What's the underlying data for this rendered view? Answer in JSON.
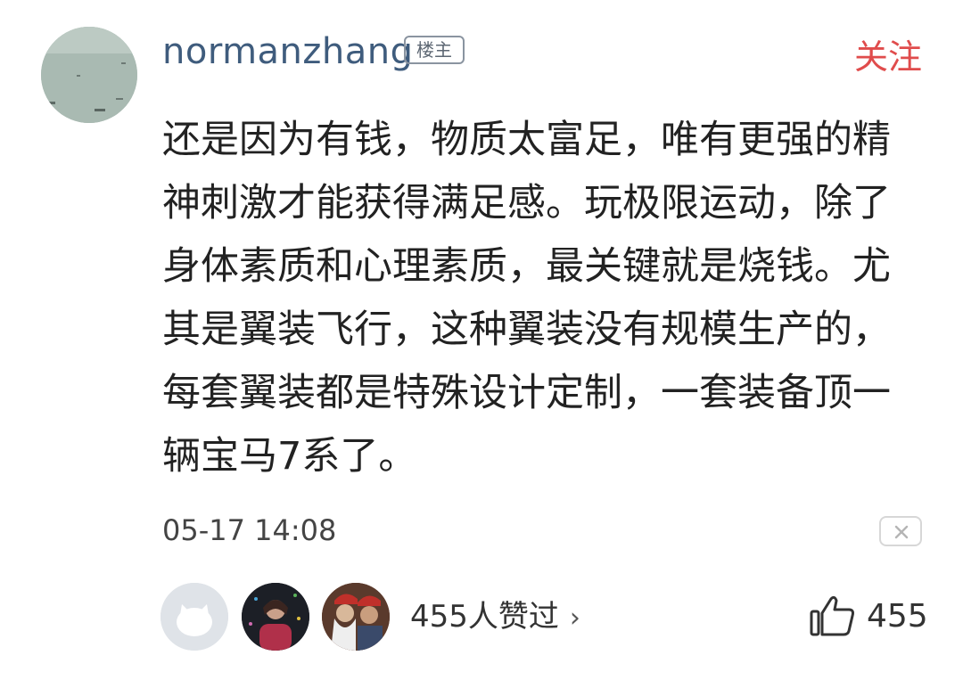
{
  "comment": {
    "username": "normanzhang",
    "badge": "楼主",
    "follow_label": "关注",
    "text": "还是因为有钱，物质太富足，唯有更强的精神刺激才能获得满足感。玩极限运动，除了身体素质和心理素质，最关键就是烧钱。尤其是翼装飞行，这种翼装没有规模生产的，每套翼装都是特殊设计定制，一套装备顶一辆宝马7系了。",
    "timestamp": "05-17 14:08"
  },
  "likes": {
    "summary": "455人赞过",
    "chevron": "›",
    "count": "455"
  },
  "colors": {
    "username": "#3f5c7d",
    "follow": "#e04c4c",
    "text": "#222222"
  },
  "icons": {
    "avatar": "lake-landscape-avatar",
    "close": "close-icon",
    "like": "thumbs-up-icon"
  }
}
